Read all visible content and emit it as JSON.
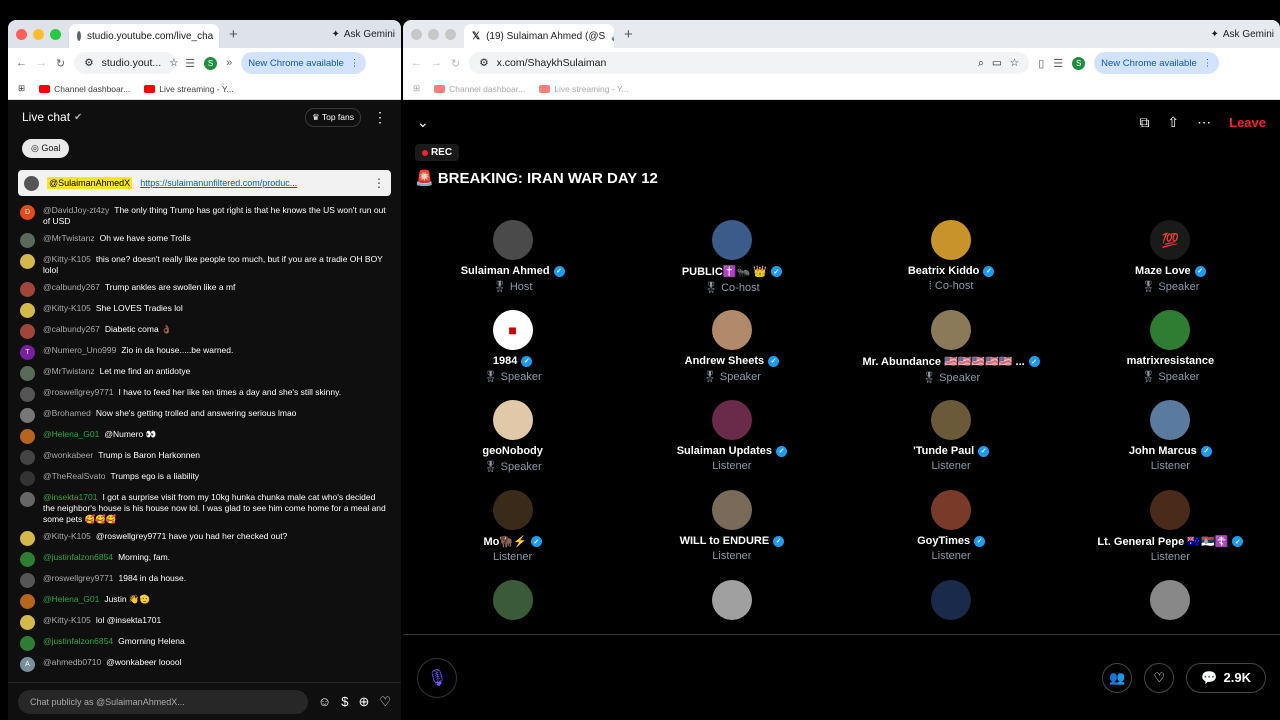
{
  "left_browser": {
    "tab_title": "studio.youtube.com/live_cha",
    "url": "studio.yout...",
    "ask_gemini": "Ask Gemini",
    "update_label": "New Chrome available",
    "profile_initial": "S",
    "bookmarks": [
      "Channel dashboar...",
      "Live streaming - Y..."
    ]
  },
  "right_browser": {
    "tab_title": "(19) Sulaiman Ahmed (@S",
    "url": "x.com/ShaykhSulaiman",
    "ask_gemini": "Ask Gemini",
    "update_label": "New Chrome available",
    "profile_initial": "S",
    "bookmarks": [
      "Channel dashboar...",
      "Live streaming - Y..."
    ]
  },
  "chat": {
    "title": "Live chat",
    "top_fans": "Top fans",
    "goal": "Goal",
    "pinned_author": "@SulaimanAhmedX",
    "pinned_link": "https://sulaimanunfiltered.com/produc...",
    "input_placeholder": "Chat publicly as @SulaimanAhmedX...",
    "messages": [
      {
        "author": "@DavidJoy-zt4zy",
        "text": "The only thing Trump has got right is that he knows the US won't run out of USD",
        "initial": "D",
        "color": "#e64a19"
      },
      {
        "author": "@MrTwistanz",
        "text": "Oh we have some Trolls",
        "initial": "",
        "color": "#5a6a5a"
      },
      {
        "author": "@Kitty-K105",
        "text": "this one? doesn't really like people too much, but if you are a tradie OH BOY lolol",
        "initial": "",
        "color": "#d4b84a"
      },
      {
        "author": "@calbundy267",
        "text": "Trump ankles are swollen like a mf",
        "initial": "",
        "color": "#a0453a"
      },
      {
        "author": "@Kitty-K105",
        "text": "She LOVES Tradies lol",
        "initial": "",
        "color": "#d4b84a"
      },
      {
        "author": "@calbundy267",
        "text": "Diabetic coma 👌🏾",
        "initial": "",
        "color": "#a0453a"
      },
      {
        "author": "@Numero_Uno999",
        "text": "Zio in da house.....be warned.",
        "initial": "T",
        "color": "#7b1fa2"
      },
      {
        "author": "@MrTwistanz",
        "text": "Let me find an antidotye",
        "initial": "",
        "color": "#5a6a5a"
      },
      {
        "author": "@roswellgrey9771",
        "text": "I have to feed her like ten times a day and she's still skinny.",
        "initial": "",
        "color": "#555"
      },
      {
        "author": "@Brohamed",
        "text": "Now she's getting trolled and answering serious lmao",
        "initial": "",
        "color": "#777"
      },
      {
        "author": "@Helena_G01",
        "text": "@Numero 👀",
        "initial": "",
        "color": "#b5651d",
        "member": true
      },
      {
        "author": "@wonkabeer",
        "text": "Trump is Baron Harkonnen",
        "initial": "",
        "color": "#444"
      },
      {
        "author": "@TheRealSvato",
        "text": "Trumps ego is a liability",
        "initial": "",
        "color": "#333"
      },
      {
        "author": "@insekta1701",
        "text": "I got a surprise visit from my 10kg hunka chunka male cat who's decided the neighbor's house is his house now lol. I was glad to see him come home for a meal and some pets 🥰🥰🥰",
        "initial": "",
        "color": "#666",
        "member": true
      },
      {
        "author": "@Kitty-K105",
        "text": "@roswellgrey9771 have you had her checked out?",
        "initial": "",
        "color": "#d4b84a"
      },
      {
        "author": "@justinfalzon6854",
        "text": "Morning, fam.",
        "initial": "",
        "color": "#2e7d32",
        "member": true
      },
      {
        "author": "@roswellgrey9771",
        "text": "1984 in da house.",
        "initial": "",
        "color": "#555"
      },
      {
        "author": "@Helena_G01",
        "text": "Justin 👋🫡",
        "initial": "",
        "color": "#b5651d",
        "member": true
      },
      {
        "author": "@Kitty-K105",
        "text": "lol @insekta1701",
        "initial": "",
        "color": "#d4b84a"
      },
      {
        "author": "@justinfalzon6854",
        "text": "Gmorning Helena",
        "initial": "",
        "color": "#2e7d32",
        "member": true
      },
      {
        "author": "@ahmedb0710",
        "text": "@wonkabeer looool",
        "initial": "A",
        "color": "#78909c"
      }
    ]
  },
  "space": {
    "rec": "REC",
    "leave": "Leave",
    "title": "🚨 BREAKING: IRAN WAR DAY 12",
    "comments_count": "2.9K",
    "participants": [
      {
        "name": "Sulaiman Ahmed",
        "role": "🎖 Host",
        "verified": true,
        "color": "#4a4a4a"
      },
      {
        "name": "PUBLIC✝️🐜 👑",
        "role": "🎖 Co-host",
        "verified": true,
        "color": "#3b5b8a"
      },
      {
        "name": "Beatrix Kiddo",
        "role": "⁞ Co-host",
        "verified": true,
        "color": "#c9932b"
      },
      {
        "name": "Maze Love",
        "role": "🎖 Speaker",
        "verified": true,
        "color": "#1a1a1a",
        "glyph": "💯"
      },
      {
        "name": "1984",
        "role": "🎖 Speaker",
        "verified": true,
        "color": "#ffffff",
        "glyph": "■"
      },
      {
        "name": "Andrew Sheets",
        "role": "🎖 Speaker",
        "verified": true,
        "color": "#b08a6a"
      },
      {
        "name": "Mr. Abundance 🇺🇸🇺🇸🇺🇸🇺🇸🇺🇸 ...",
        "role": "🎖 Speaker",
        "verified": true,
        "color": "#8a7a5a"
      },
      {
        "name": "matrixresistance",
        "role": "🎖 Speaker",
        "verified": false,
        "color": "#2e7d32"
      },
      {
        "name": "geoNobody",
        "role": "🎖 Speaker",
        "verified": false,
        "color": "#e0c8a8"
      },
      {
        "name": "Sulaiman Updates",
        "role": "Listener",
        "verified": true,
        "color": "#6a2a4a"
      },
      {
        "name": "'Tunde Paul",
        "role": "Listener",
        "verified": true,
        "color": "#6a5a3a"
      },
      {
        "name": "John Marcus",
        "role": "Listener",
        "verified": true,
        "color": "#5a7aa0"
      },
      {
        "name": "Mo🦬⚡",
        "role": "Listener",
        "verified": true,
        "color": "#3a2a1a"
      },
      {
        "name": "WILL to ENDURE",
        "role": "Listener",
        "verified": true,
        "color": "#7a6a5a"
      },
      {
        "name": "GoyTimes",
        "role": "Listener",
        "verified": true,
        "color": "#7a3a2a"
      },
      {
        "name": "Lt. General Pepe 🇦🇺🇷🇸☦️",
        "role": "Listener",
        "verified": true,
        "color": "#4a2a1a"
      },
      {
        "name": "",
        "role": "",
        "verified": false,
        "color": "#3a5a3a"
      },
      {
        "name": "",
        "role": "",
        "verified": false,
        "color": "#a0a0a0"
      },
      {
        "name": "",
        "role": "",
        "verified": false,
        "color": "#1a2a4a"
      },
      {
        "name": "",
        "role": "",
        "verified": false,
        "color": "#888888"
      }
    ]
  }
}
